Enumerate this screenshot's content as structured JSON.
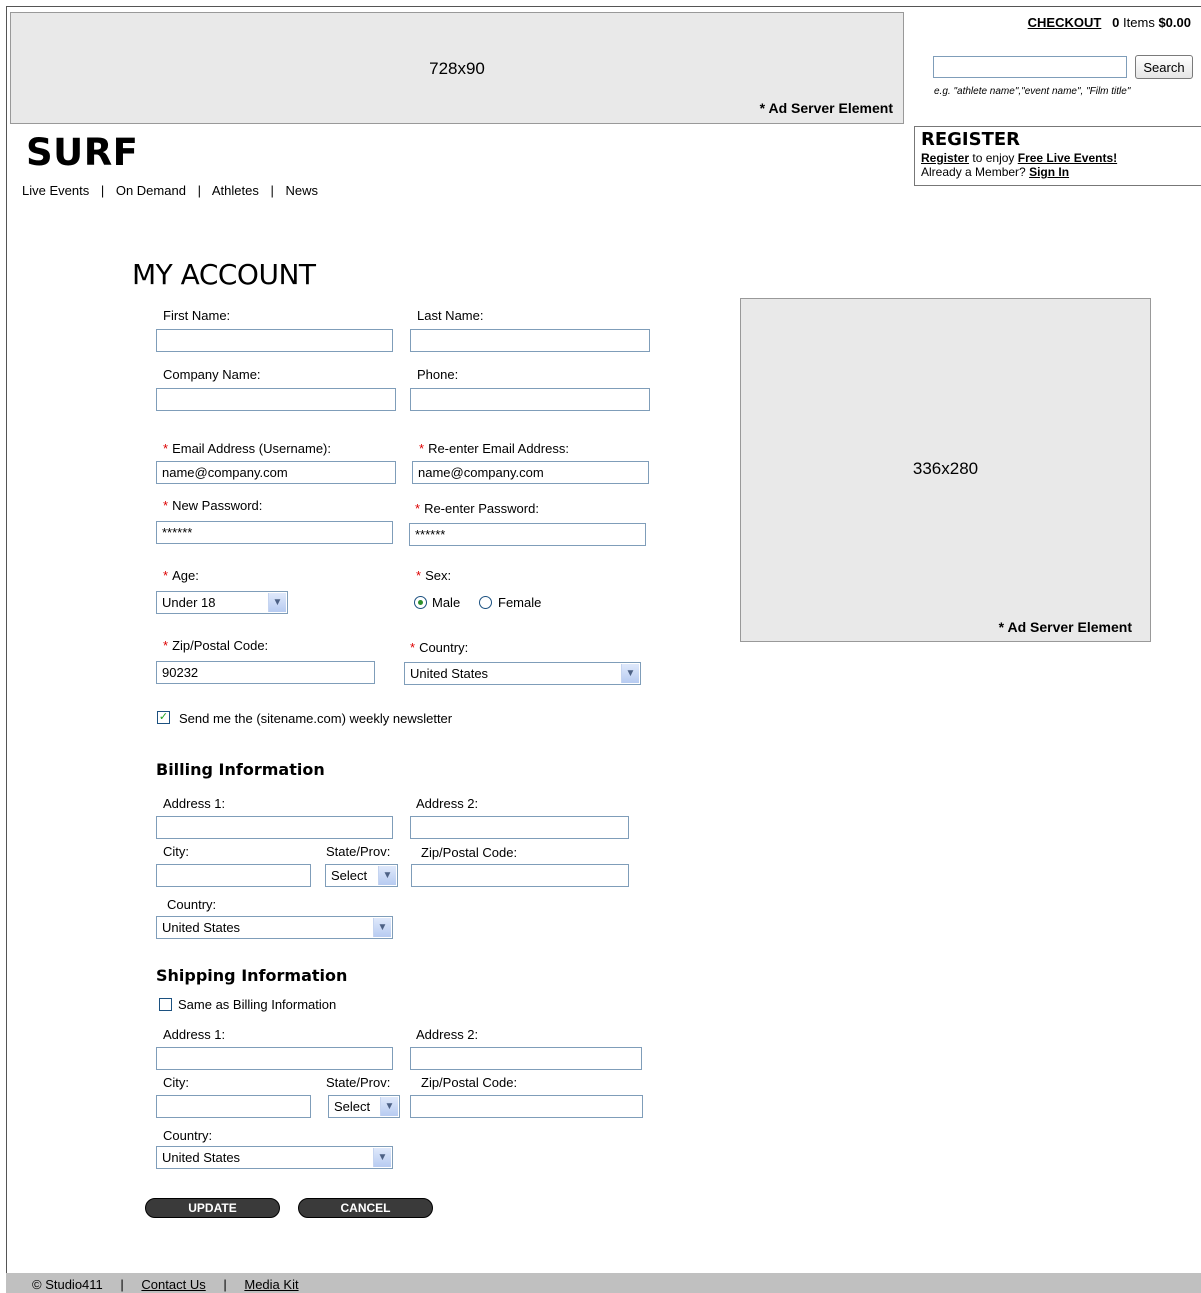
{
  "header": {
    "ad_banner": {
      "size": "728x90",
      "note": "* Ad Server Element"
    },
    "cart": {
      "checkout_label": "CHECKOUT",
      "count": "0",
      "items_label": "Items",
      "total": "$0.00"
    },
    "search": {
      "button_label": "Search",
      "value": "",
      "hint": "e.g. \"athlete name\",\"event name\", \"Film title\""
    },
    "register": {
      "title": "REGISTER",
      "register_link": "Register",
      "enjoy_text": "to enjoy",
      "free_events_link": "Free Live Events!",
      "member_text": "Already a Member?",
      "signin_link": "Sign In"
    },
    "logo": "SURF",
    "nav": [
      "Live Events",
      "On Demand",
      "Athletes",
      "News"
    ],
    "nav_separator": "|"
  },
  "page_title": "MY ACCOUNT",
  "required_mark": "*",
  "account": {
    "first_name": {
      "label": "First Name:",
      "value": ""
    },
    "last_name": {
      "label": "Last Name:",
      "value": ""
    },
    "company": {
      "label": "Company Name:",
      "value": ""
    },
    "phone": {
      "label": "Phone:",
      "value": ""
    },
    "email": {
      "label": "Email Address (Username):",
      "value": "name@company.com"
    },
    "email_confirm": {
      "label": "Re-enter Email Address:",
      "value": "name@company.com"
    },
    "password": {
      "label": "New Password:",
      "value": "******"
    },
    "password_confirm": {
      "label": "Re-enter Password:",
      "value": "******"
    },
    "age": {
      "label": "Age:",
      "value": "Under 18"
    },
    "sex": {
      "label": "Sex:",
      "options": [
        "Male",
        "Female"
      ],
      "selected": "Male"
    },
    "zip": {
      "label": "Zip/Postal Code:",
      "value": "90232"
    },
    "country": {
      "label": "Country:",
      "value": "United States"
    },
    "newsletter": {
      "label": "Send me the (sitename.com) weekly newsletter",
      "checked": true
    }
  },
  "billing": {
    "title": "Billing Information",
    "address1": {
      "label": "Address 1:",
      "value": ""
    },
    "address2": {
      "label": "Address 2:",
      "value": ""
    },
    "city": {
      "label": "City:",
      "value": ""
    },
    "state": {
      "label": "State/Prov:",
      "value": "Select"
    },
    "zip": {
      "label": "Zip/Postal Code:",
      "value": ""
    },
    "country": {
      "label": "Country:",
      "value": "United States"
    }
  },
  "shipping": {
    "title": "Shipping Information",
    "same_as_billing": {
      "label": "Same as Billing Information",
      "checked": false
    },
    "address1": {
      "label": "Address 1:",
      "value": ""
    },
    "address2": {
      "label": "Address 2:",
      "value": ""
    },
    "city": {
      "label": "City:",
      "value": ""
    },
    "state": {
      "label": "State/Prov:",
      "value": "Select"
    },
    "zip": {
      "label": "Zip/Postal Code:",
      "value": ""
    },
    "country": {
      "label": "Country:",
      "value": "United States"
    }
  },
  "buttons": {
    "update": "UPDATE",
    "cancel": "CANCEL"
  },
  "side_ad": {
    "size": "336x280",
    "note": "* Ad Server Element"
  },
  "footer": {
    "copyright": "© Studio411",
    "contact": "Contact Us",
    "media_kit": "Media Kit",
    "separator": "|"
  },
  "icons": {
    "dropdown": "chevron-down-icon",
    "checkbox_mark": "checkmark-icon"
  }
}
